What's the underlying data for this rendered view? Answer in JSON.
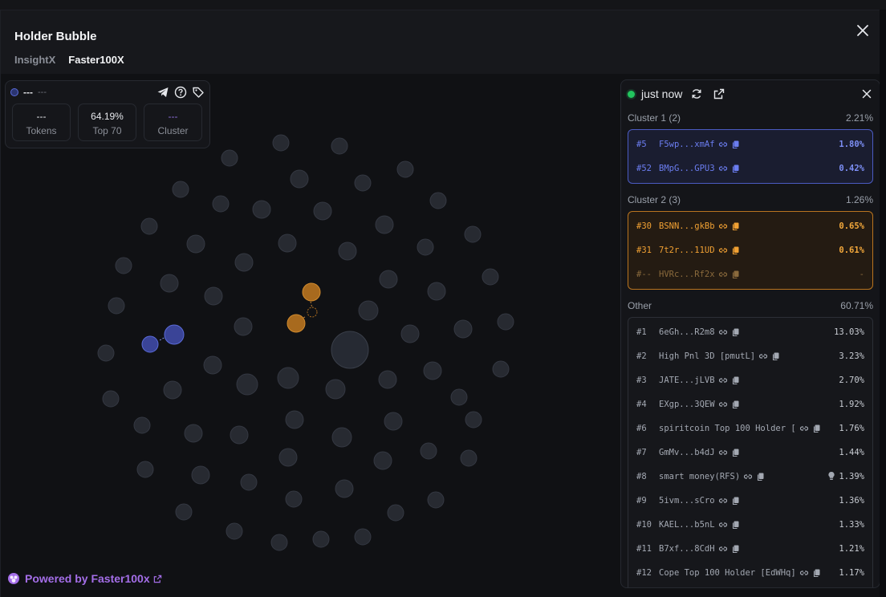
{
  "header": {
    "title": "Holder Bubble",
    "tabs": [
      {
        "label": "InsightX",
        "active": false
      },
      {
        "label": "Faster100X",
        "active": true
      }
    ]
  },
  "stats": {
    "name": "---",
    "sub": "---",
    "tokens": {
      "value": "---",
      "label": "Tokens"
    },
    "top70": {
      "value": "64.19%",
      "label": "Top 70"
    },
    "cluster": {
      "value": "---",
      "label": "Cluster"
    }
  },
  "panel": {
    "time": "just now",
    "cluster1": {
      "title": "Cluster 1 (2)",
      "pct": "2.21%",
      "rows": [
        {
          "rank": "#5",
          "name": "F5wp...xmAf",
          "pct": "1.80%"
        },
        {
          "rank": "#52",
          "name": "BMpG...GPU3",
          "pct": "0.42%"
        }
      ]
    },
    "cluster2": {
      "title": "Cluster 2 (3)",
      "pct": "1.26%",
      "rows": [
        {
          "rank": "#30",
          "name": "BSNN...gkBb",
          "pct": "0.65%"
        },
        {
          "rank": "#31",
          "name": "7t2r...11UD",
          "pct": "0.61%"
        },
        {
          "rank": "#--",
          "name": "HVRc...Rf2x",
          "pct": "-"
        }
      ]
    },
    "other": {
      "title": "Other",
      "pct": "60.71%",
      "rows": [
        {
          "rank": "#1",
          "name": "6eGh...R2m8",
          "pct": "13.03%"
        },
        {
          "rank": "#2",
          "name": "High Pnl 3D [pmutL]",
          "pct": "3.23%"
        },
        {
          "rank": "#3",
          "name": "JATE...jLVB",
          "pct": "2.70%"
        },
        {
          "rank": "#4",
          "name": "EXgp...3QEW",
          "pct": "1.92%"
        },
        {
          "rank": "#6",
          "name": "spiritcoin Top 100 Holder [",
          "pct": "1.76%"
        },
        {
          "rank": "#7",
          "name": "GmMv...b4dJ",
          "pct": "1.44%"
        },
        {
          "rank": "#8",
          "name": "smart money(RFS)",
          "pct": "1.39%"
        },
        {
          "rank": "#9",
          "name": "5ivm...sCro",
          "pct": "1.36%"
        },
        {
          "rank": "#10",
          "name": "KAEL...b5nL",
          "pct": "1.33%"
        },
        {
          "rank": "#11",
          "name": "B7xf...8CdH",
          "pct": "1.21%"
        },
        {
          "rank": "#12",
          "name": "Cope Top 100 Holder [EdWHq]",
          "pct": "1.17%"
        }
      ]
    }
  },
  "footer": {
    "powered_prefix": "Powered by ",
    "powered_brand": "Faster100x"
  },
  "colors": {
    "cluster1": "#4b5bc2",
    "cluster2": "#b9741f",
    "brand": "#a46ee8",
    "live": "#22c55e"
  },
  "bubble_map": {
    "big_bubble": {
      "rank": "#1",
      "share": "13.03%"
    },
    "clusters": [
      {
        "name": "Cluster 1",
        "color": "blue",
        "members": 2
      },
      {
        "name": "Cluster 2",
        "color": "orange",
        "members": 3
      }
    ]
  }
}
